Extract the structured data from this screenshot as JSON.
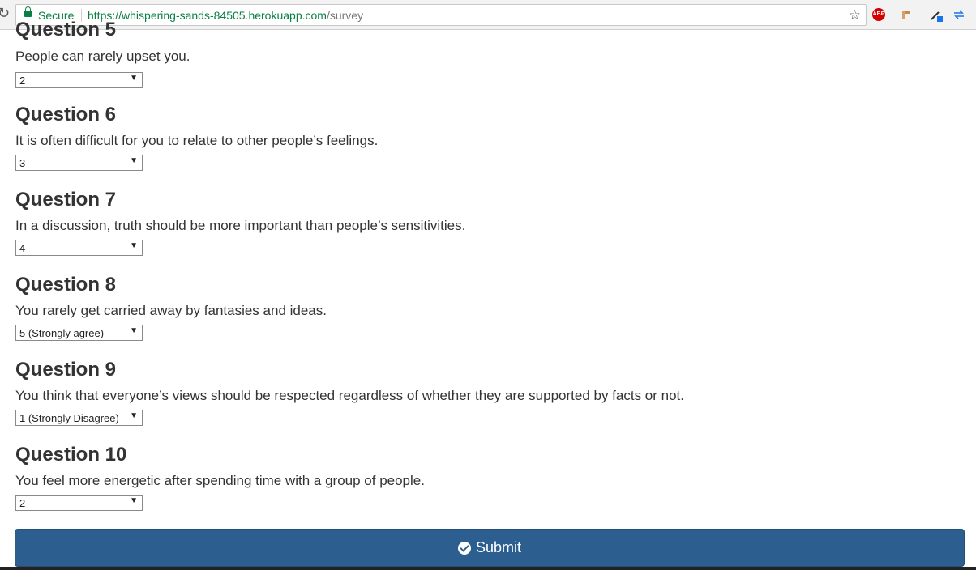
{
  "browser": {
    "secure_label": "Secure",
    "url_host": "https://whispering-sands-84505.herokuapp.com",
    "url_path": "/survey",
    "abp_label": "ABP"
  },
  "questions": [
    {
      "title": "Question 5",
      "text": "People can rarely upset you.",
      "selected": "2"
    },
    {
      "title": "Question 6",
      "text": "It is often difficult for you to relate to other people’s feelings.",
      "selected": "3"
    },
    {
      "title": "Question 7",
      "text": "In a discussion, truth should be more important than people’s sensitivities.",
      "selected": "4"
    },
    {
      "title": "Question 8",
      "text": "You rarely get carried away by fantasies and ideas.",
      "selected": "5 (Strongly agree)"
    },
    {
      "title": "Question 9",
      "text": "You think that everyone’s views should be respected regardless of whether they are supported by facts or not.",
      "selected": "1 (Strongly Disagree)"
    },
    {
      "title": "Question 10",
      "text": "You feel more energetic after spending time with a group of people.",
      "selected": "2"
    }
  ],
  "submit_label": "Submit",
  "colors": {
    "submit_bg": "#2c5f8f",
    "secure_green": "#0b8043"
  }
}
